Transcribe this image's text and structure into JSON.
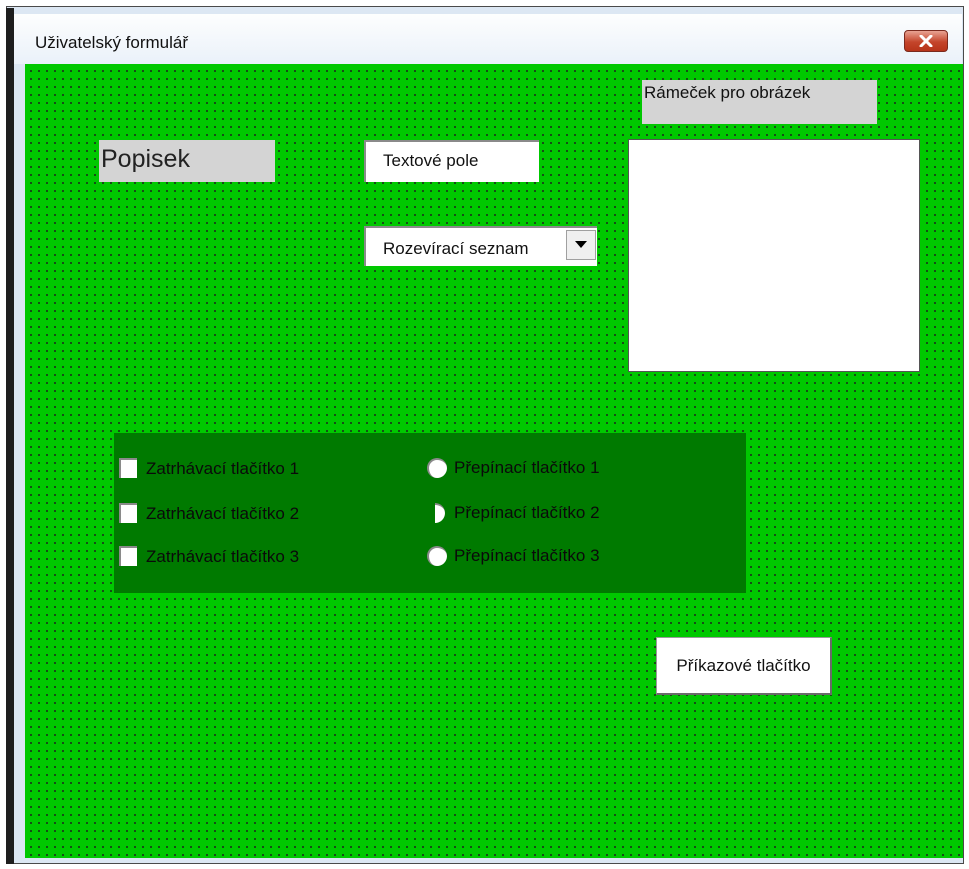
{
  "window": {
    "title": "Uživatelský formulář",
    "close_icon": "close-icon"
  },
  "form": {
    "label": "Popisek",
    "textbox_value": "Textové pole",
    "combo": {
      "selected": "Rozevírací seznam",
      "icon": "chevron-down-icon"
    },
    "frame_label": "Rámeček pro obrázek",
    "checkboxes": [
      {
        "label": "Zatrhávací tlačítko 1"
      },
      {
        "label": "Zatrhávací tlačítko 2"
      },
      {
        "label": "Zatrhávací tlačítko 3"
      }
    ],
    "options": [
      {
        "label": "Přepínací tlačítko 1"
      },
      {
        "label": "Přepínací tlačítko 2"
      },
      {
        "label": "Přepínací tlačítko 3"
      }
    ],
    "command_button": "Příkazové tlačítko"
  },
  "colors": {
    "form_background": "#00c800",
    "group_background": "#007a00",
    "close_button": "#c4452b"
  }
}
